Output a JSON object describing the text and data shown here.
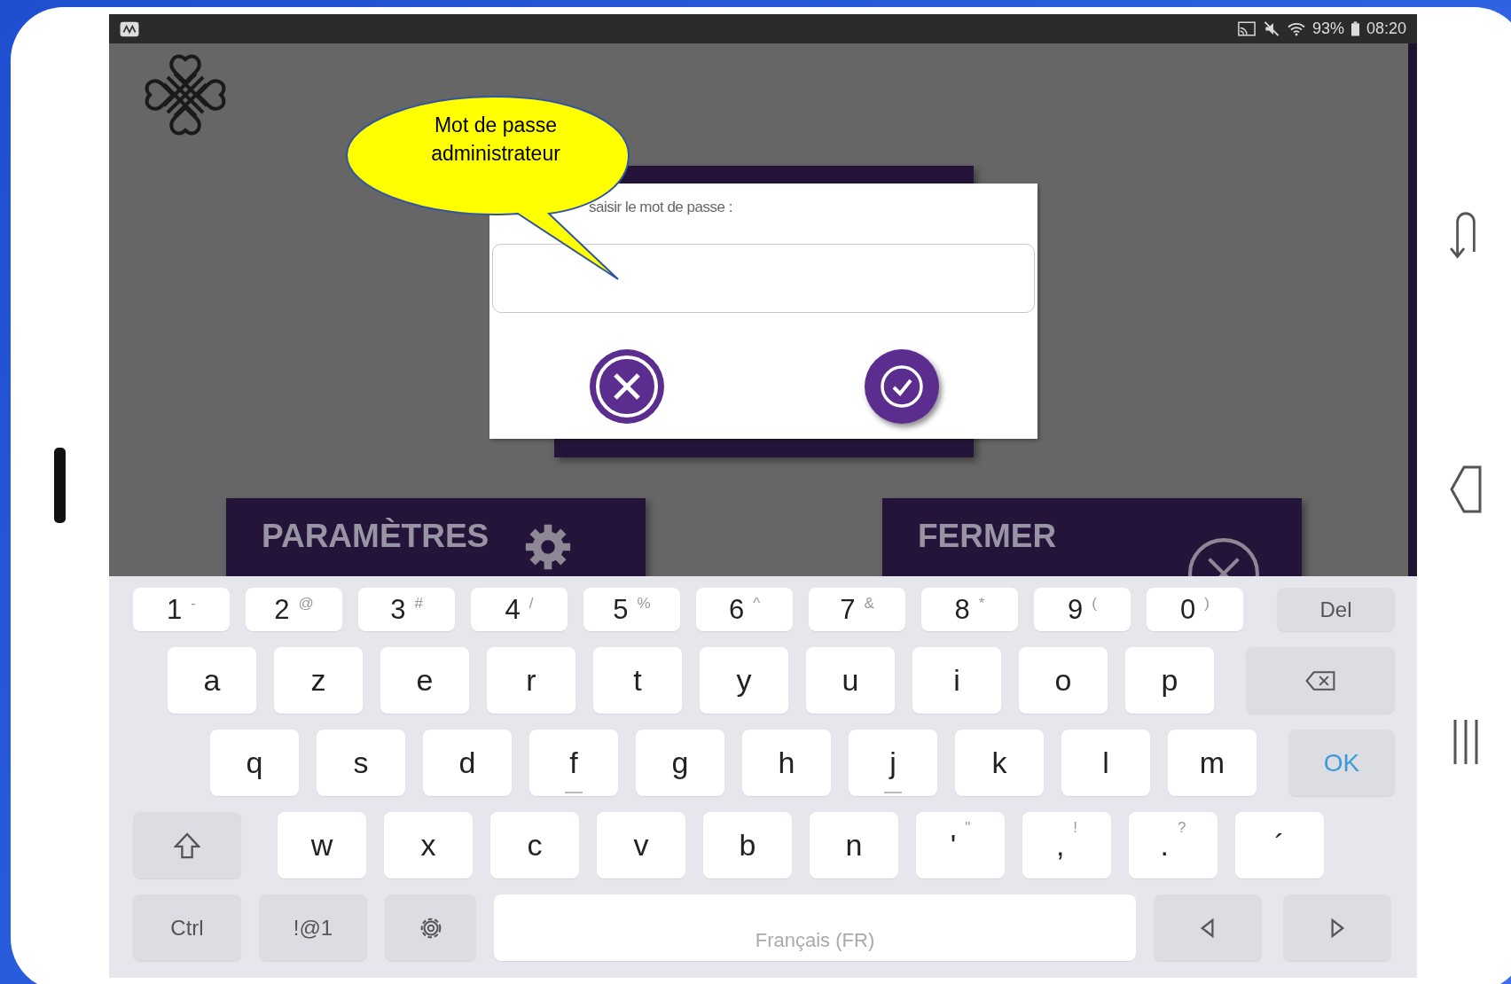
{
  "status_bar": {
    "battery": "93%",
    "time": "08:20"
  },
  "callout": {
    "text": "Mot de passe administrateur"
  },
  "dialog": {
    "label": "saisir le mot de passe :",
    "buttons": [
      {
        "kind": "cancel"
      },
      {
        "kind": "confirm"
      }
    ]
  },
  "menu_tiles": [
    {
      "label": "PARAMÈTRES",
      "kind": "settings"
    },
    {
      "label": "FERMER",
      "kind": "close"
    }
  ],
  "keyboard": {
    "rows": [
      {
        "keys": [
          {
            "kind": "char",
            "label": "1",
            "alt": "-"
          },
          {
            "kind": "char",
            "label": "2",
            "alt": "@"
          },
          {
            "kind": "char",
            "label": "3",
            "alt": "#"
          },
          {
            "kind": "char",
            "label": "4",
            "alt": "/"
          },
          {
            "kind": "char",
            "label": "5",
            "alt": "%"
          },
          {
            "kind": "char",
            "label": "6",
            "alt": "^"
          },
          {
            "kind": "char",
            "label": "7",
            "alt": "&"
          },
          {
            "kind": "char",
            "label": "8",
            "alt": "*"
          },
          {
            "kind": "char",
            "label": "9",
            "alt": "("
          },
          {
            "kind": "char",
            "label": "0",
            "alt": ")"
          },
          {
            "kind": "text",
            "label": "Del"
          }
        ]
      },
      {
        "keys": [
          {
            "kind": "char",
            "label": "a"
          },
          {
            "kind": "char",
            "label": "z"
          },
          {
            "kind": "char",
            "label": "e"
          },
          {
            "kind": "char",
            "label": "r"
          },
          {
            "kind": "char",
            "label": "t"
          },
          {
            "kind": "char",
            "label": "y"
          },
          {
            "kind": "char",
            "label": "u"
          },
          {
            "kind": "char",
            "label": "i"
          },
          {
            "kind": "char",
            "label": "o"
          },
          {
            "kind": "char",
            "label": "p"
          },
          {
            "kind": "backspace"
          }
        ]
      },
      {
        "keys": [
          {
            "kind": "char",
            "label": "q"
          },
          {
            "kind": "char",
            "label": "s"
          },
          {
            "kind": "char",
            "label": "d"
          },
          {
            "kind": "char",
            "label": "f",
            "bump": true
          },
          {
            "kind": "char",
            "label": "g"
          },
          {
            "kind": "char",
            "label": "h"
          },
          {
            "kind": "char",
            "label": "j",
            "bump": true
          },
          {
            "kind": "char",
            "label": "k"
          },
          {
            "kind": "char",
            "label": "l"
          },
          {
            "kind": "char",
            "label": "m"
          },
          {
            "kind": "action",
            "label": "OK"
          }
        ]
      },
      {
        "keys": [
          {
            "kind": "shift"
          },
          {
            "kind": "char",
            "label": "w"
          },
          {
            "kind": "char",
            "label": "x"
          },
          {
            "kind": "char",
            "label": "c"
          },
          {
            "kind": "char",
            "label": "v"
          },
          {
            "kind": "char",
            "label": "b"
          },
          {
            "kind": "char",
            "label": "n"
          },
          {
            "kind": "char",
            "label": "'",
            "alt": "\""
          },
          {
            "kind": "char",
            "label": ",",
            "alt": "!"
          },
          {
            "kind": "char",
            "label": ".",
            "alt": "?"
          },
          {
            "kind": "char",
            "label": "´"
          }
        ]
      },
      {
        "keys": [
          {
            "kind": "text",
            "label": "Ctrl"
          },
          {
            "kind": "text",
            "label": "!@1"
          },
          {
            "kind": "settings"
          },
          {
            "kind": "space",
            "label": "Français (FR)"
          },
          {
            "kind": "arrow_left"
          },
          {
            "kind": "arrow_right"
          }
        ]
      }
    ]
  }
}
